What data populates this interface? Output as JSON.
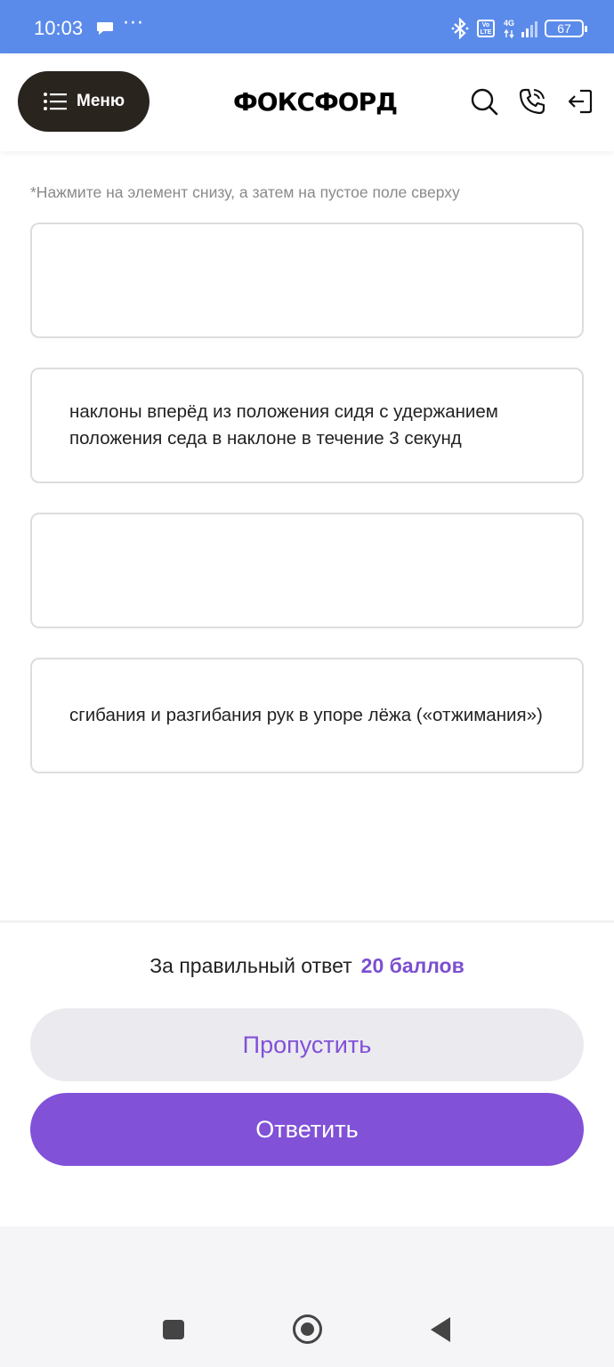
{
  "status_bar": {
    "time": "10:03",
    "dots": "···",
    "volte_label": "Vo LTE",
    "network_label": "4G",
    "battery_level": "67",
    "icons": [
      "chat-bubble-icon",
      "bluetooth-icon",
      "volte-icon",
      "signal-icon",
      "battery-icon"
    ]
  },
  "header": {
    "menu_label": "Меню",
    "logo_text": "ФОКСФОРД",
    "icons": [
      "search-icon",
      "phone-icon",
      "logout-icon"
    ]
  },
  "task": {
    "hint": "*Нажмите на элемент снизу, а затем на пустое поле сверху",
    "slots": [
      {
        "text": ""
      },
      {
        "text": "наклоны вперёд из положения сидя с удержанием положения седа в наклоне в течение 3 секунд"
      },
      {
        "text": ""
      },
      {
        "text": "сгибания и разгибания рук в упоре лёжа («отжимания»)"
      }
    ]
  },
  "footer": {
    "score_prefix": "За правильный ответ",
    "score_value": "20 баллов",
    "skip_label": "Пропустить",
    "answer_label": "Ответить"
  },
  "colors": {
    "status_bar": "#5b8bea",
    "menu_button": "#2a241f",
    "accent": "#8151d8",
    "skip_bg": "#ebebef"
  },
  "nav_bar": {
    "icons": [
      "recent-apps-icon",
      "home-icon",
      "back-icon"
    ]
  }
}
